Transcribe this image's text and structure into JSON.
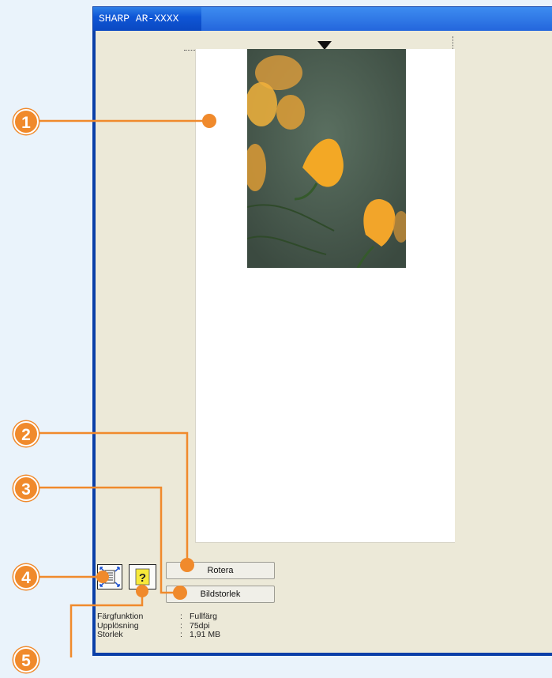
{
  "window": {
    "title": "SHARP AR-XXXX"
  },
  "buttons": {
    "rotate_label": "Rotera",
    "size_label": "Bildstorlek"
  },
  "icons": {
    "zoom": "zoom-fit-icon",
    "help": "help-icon"
  },
  "info": [
    {
      "label": "Färgfunktion",
      "sep": ":",
      "value": "Fullfärg"
    },
    {
      "label": "Upplösning",
      "sep": ":",
      "value": "75dpi"
    },
    {
      "label": "Storlek",
      "sep": ":",
      "value": "1,91 MB"
    }
  ],
  "callouts": [
    "1",
    "2",
    "3",
    "4",
    "5"
  ],
  "colors": {
    "callout": "#f08a2c",
    "titlebar": "#0f56d6",
    "window_bg": "#ece9d8"
  }
}
